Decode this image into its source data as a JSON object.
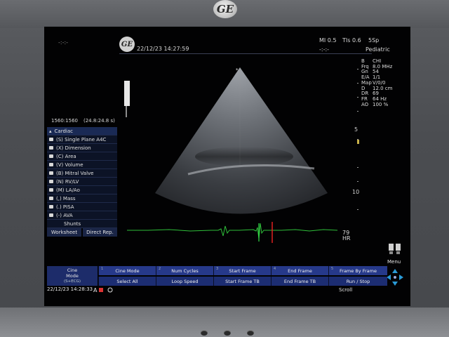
{
  "brand": {
    "logo_text": "GE",
    "screen_logo_text": "GE"
  },
  "header": {
    "datetime": "22/12/23 14:27:59",
    "cursor_mark": "-:-:-",
    "mi": "MI 0.5",
    "tis": "TIs 0.6",
    "sp": "5Sp",
    "timer": "-:-:-",
    "preset": "Pediatric"
  },
  "params": [
    {
      "k": "B",
      "v": "CHI"
    },
    {
      "k": "Frq",
      "v": "8.0 MHz"
    },
    {
      "k": "Gn",
      "v": "54"
    },
    {
      "k": "E/A",
      "v": "1/1"
    },
    {
      "k": "Map",
      "v": "V/0/0"
    },
    {
      "k": "D",
      "v": "12.0 cm"
    },
    {
      "k": "DR",
      "v": "69"
    },
    {
      "k": "FR",
      "v": "64 Hz"
    },
    {
      "k": "AO",
      "v": "100 %"
    }
  ],
  "depth_marks": [
    "5",
    "10"
  ],
  "cine": {
    "counter": "1560:1560",
    "time": "(24.8:24.8 s)"
  },
  "measure_menu": {
    "title": "Cardiac",
    "items": [
      "(S) Single Plane A4C",
      "(X) Dimension",
      "(C) Area",
      "(V) Volume",
      "(B) Mitral Valve",
      "(N) RV/LV",
      "(M) LA/Ao",
      "(,) Mass",
      "(.) PISA",
      "(-) AVA",
      "Shunts"
    ],
    "tabs": [
      "Worksheet",
      "Direct Rep."
    ]
  },
  "ecg": {
    "hr_value": "79",
    "hr_unit": "HR"
  },
  "softkeys": {
    "label_line1": "Cine",
    "label_line2": "Mode",
    "label_line3": "(S+ECG)",
    "row1": [
      "Cine Mode",
      "Num Cycles",
      "Start Frame",
      "End Frame",
      "Frame By Frame"
    ],
    "row2": [
      "Select All",
      "Loop Speed",
      "Start Frame TB",
      "End Frame TB",
      "Run / Stop"
    ],
    "numbers": [
      "1",
      "2",
      "3",
      "4",
      "5"
    ]
  },
  "status": {
    "datetime": "22/12/23 14:28:33",
    "scroll": "Scroll",
    "menu": "Menu"
  }
}
